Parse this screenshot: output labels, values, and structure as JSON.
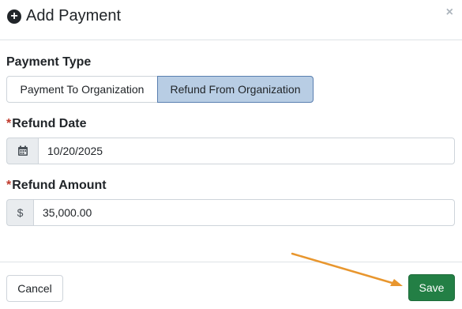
{
  "modal": {
    "title": "Add Payment",
    "close_label": "×"
  },
  "payment_type": {
    "label": "Payment Type",
    "options": [
      "Payment To Organization",
      "Refund From Organization"
    ],
    "selected": "Refund From Organization"
  },
  "refund_date": {
    "required_mark": "*",
    "label": "Refund Date",
    "value": "10/20/2025"
  },
  "refund_amount": {
    "required_mark": "*",
    "label": "Refund Amount",
    "currency_symbol": "$",
    "value": "35,000.00"
  },
  "footer": {
    "cancel_label": "Cancel",
    "save_label": "Save"
  },
  "colors": {
    "save_button": "#237f45",
    "selected_option": "#b8cde4",
    "annotation_arrow": "#e8962e"
  },
  "icons": [
    "plus-circle-icon",
    "close-icon",
    "calendar-icon"
  ]
}
